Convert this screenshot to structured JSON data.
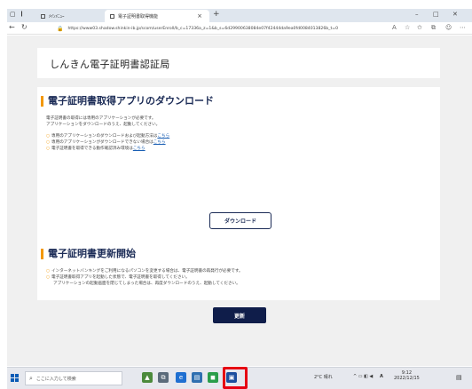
{
  "browser": {
    "tabs": [
      {
        "label": "ﾒｲﾝﾒﾆｭｰ",
        "active": false
      },
      {
        "label": "電子証明書取得機能",
        "active": true
      }
    ],
    "address": "https://www03.shadow.shinkin-ib.jp/scom/userEnroll/b_c=17336a_z=1&b_s=6d29900638084e07f42444da9ea0fd0084013826b_t=0",
    "window_controls": [
      "–",
      "□",
      "✕"
    ]
  },
  "page": {
    "site_title": "しんきん電子証明書認証局",
    "section1": {
      "title": "電子証明書取得アプリのダウンロード",
      "lines": [
        "電子証明書の取得には専用のアプリケーションが必要です。",
        "アプリケーションをダウンロードのうえ、起動してください。"
      ],
      "bullets": [
        {
          "text": "専用のアプリケーションのダウンロードおよび起動方法は",
          "link": "こちら"
        },
        {
          "text": "専用のアプリケーションがダウンロードできない場合は",
          "link": "こちら"
        },
        {
          "text": "電子証明書を取得できる動作確認済み環境は",
          "link": "こちら"
        }
      ],
      "button": "ダウンロード"
    },
    "section2": {
      "title": "電子証明書更新開始",
      "bullets": [
        "インターネットバンキングをご利用になるパソコンを変更する場合は、電子証明書の再発行が必要です。",
        "電子証明書取得アプリを起動した状態で、電子証明書を取得してください。",
        "アプリケーションの起動画面を閉じてしまった場合は、再度ダウンロードのうえ、起動してください。"
      ],
      "button": "更新"
    }
  },
  "taskbar": {
    "search_placeholder": "ここに入力して検索",
    "weather": "2°C 晴れ",
    "ime": "A",
    "time": "9:12",
    "date": "2022/12/15"
  },
  "colors": {
    "accent": "#f39800",
    "navy": "#0f1d4a",
    "highlight": "#e60012"
  }
}
